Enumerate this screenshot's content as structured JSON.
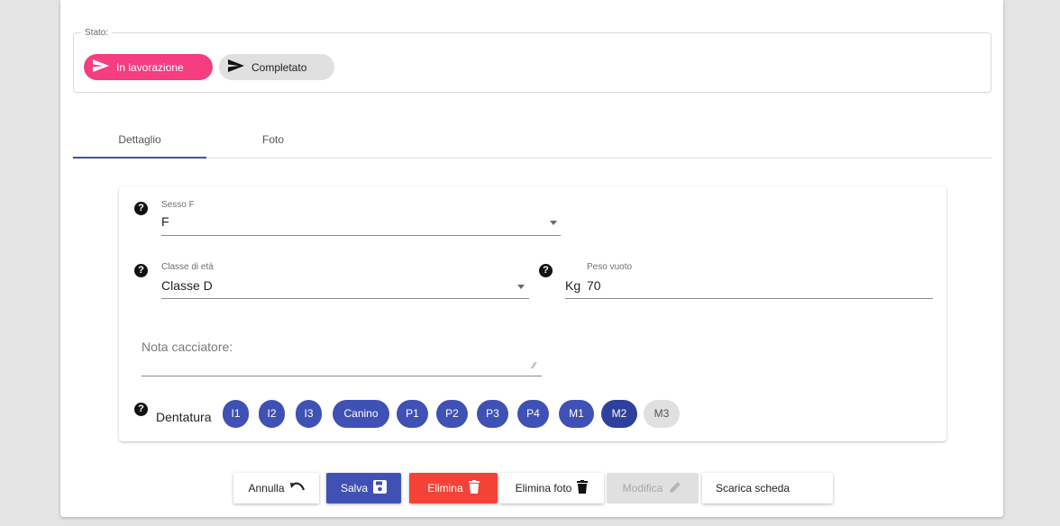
{
  "status": {
    "legend": "Stato:",
    "chips": [
      {
        "label": "In lavorazione",
        "active": true,
        "color": "#f53d7f"
      },
      {
        "label": "Completato",
        "active": false,
        "color": "#e0e0e0"
      }
    ]
  },
  "tabs": [
    {
      "label": "Dettaglio",
      "selected": true
    },
    {
      "label": "Foto",
      "selected": false
    }
  ],
  "form": {
    "sesso": {
      "label": "Sesso F",
      "value": "F"
    },
    "classe": {
      "label": "Classe di età",
      "value": "Classe D"
    },
    "peso": {
      "label": "Peso vuoto",
      "unit": "Kg",
      "value": "70"
    },
    "nota": {
      "placeholder": "Nota cacciatore:"
    },
    "help_glyph": "?",
    "dentatura": {
      "label": "Dentatura",
      "teeth": [
        {
          "label": "I1",
          "selected": true
        },
        {
          "label": "I2",
          "selected": true
        },
        {
          "label": "I3",
          "selected": true
        },
        {
          "label": "Canino",
          "selected": true
        },
        {
          "label": "P1",
          "selected": true
        },
        {
          "label": "P2",
          "selected": true
        },
        {
          "label": "P3",
          "selected": true
        },
        {
          "label": "P4",
          "selected": true
        },
        {
          "label": "M1",
          "selected": true
        },
        {
          "label": "M2",
          "selected": true
        },
        {
          "label": "M3",
          "selected": false
        }
      ]
    }
  },
  "actions": {
    "annulla": "Annulla",
    "salva": "Salva",
    "elimina": "Elimina",
    "elimina_foto": "Elimina foto",
    "modifica": "Modifica",
    "scarica": "Scarica scheda"
  },
  "colors": {
    "primary": "#3f51b5",
    "accent": "#f53d7f",
    "danger": "#f44336"
  }
}
